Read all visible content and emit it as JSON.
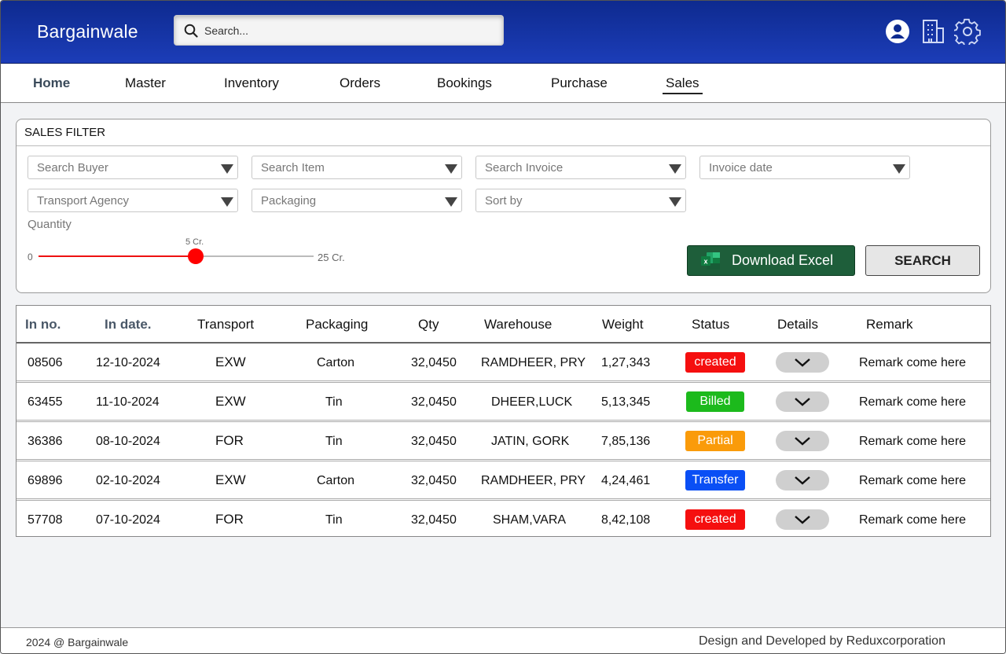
{
  "app": {
    "brand": "Bargainwale"
  },
  "search": {
    "placeholder": "Search..."
  },
  "header_icons": [
    "user-avatar-icon",
    "building-icon",
    "gear-icon"
  ],
  "nav": {
    "items": [
      "Home",
      "Master",
      "Inventory",
      "Orders",
      "Bookings",
      "Purchase",
      "Sales"
    ],
    "active": "Sales"
  },
  "filter": {
    "title": "SALES FILTER",
    "selects": [
      "Search Buyer",
      "Search Item",
      "Search Invoice",
      "Invoice date",
      "Transport Agency",
      "Packaging",
      "Sort by"
    ],
    "quantity_label": "Quantity",
    "range_min": "0",
    "range_max": "25 Cr.",
    "range_value": "5 Cr.",
    "range_fraction": 0.57,
    "download_label": "Download Excel",
    "search_label": "SEARCH"
  },
  "table": {
    "headers": [
      "In no.",
      "In date.",
      "Transport",
      "Packaging",
      "Qty",
      "Warehouse",
      "Weight",
      "Status",
      "Details",
      "Remark"
    ],
    "rows": [
      {
        "in_no": "08506",
        "in_date": "12-10-2024",
        "transport": "EXW",
        "packaging": "Carton",
        "qty": "32,0450",
        "warehouse": "RAMDHEER, PRY",
        "weight": "1,27,343",
        "status": "created",
        "remark": "Remark come here"
      },
      {
        "in_no": "63455",
        "in_date": "11-10-2024",
        "transport": "EXW",
        "packaging": "Tin",
        "qty": "32,0450",
        "warehouse": "DHEER,LUCK",
        "weight": "5,13,345",
        "status": "Billed",
        "remark": "Remark come here"
      },
      {
        "in_no": "36386",
        "in_date": "08-10-2024",
        "transport": "FOR",
        "packaging": "Tin",
        "qty": "32,0450",
        "warehouse": "JATIN, GORK",
        "weight": "7,85,136",
        "status": "Partial",
        "remark": "Remark come here"
      },
      {
        "in_no": "69896",
        "in_date": "02-10-2024",
        "transport": "EXW",
        "packaging": "Carton",
        "qty": "32,0450",
        "warehouse": "RAMDHEER, PRY",
        "weight": "4,24,461",
        "status": "Transfer",
        "remark": "Remark come here"
      },
      {
        "in_no": "57708",
        "in_date": "07-10-2024",
        "transport": "FOR",
        "packaging": "Tin",
        "qty": "32,0450",
        "warehouse": "SHAM,VARA",
        "weight": "8,42,108",
        "status": "created",
        "remark": "Remark come here"
      }
    ],
    "status_colors": {
      "created": "#f50f0f",
      "Billed": "#1cba1c",
      "Partial": "#fa9b0a",
      "Transfer": "#0a4ff5"
    }
  },
  "footer": {
    "left": "2024 @ Bargainwale",
    "right": "Design and Developed by Reduxcorporation"
  }
}
